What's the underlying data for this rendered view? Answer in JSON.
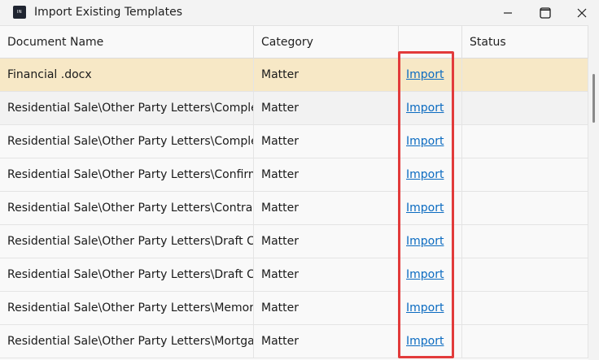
{
  "window": {
    "title": "Import Existing Templates",
    "app_icon_text": "IN"
  },
  "columns": {
    "document_name": "Document Name",
    "category": "Category",
    "action": "",
    "status": "Status"
  },
  "rows": [
    {
      "name": "Financial .docx",
      "category": "Matter",
      "action": "Import",
      "status": ""
    },
    {
      "name": "Residential Sale\\Other Party Letters\\Completion",
      "category": "Matter",
      "action": "Import",
      "status": ""
    },
    {
      "name": "Residential Sale\\Other Party Letters\\Completion",
      "category": "Matter",
      "action": "Import",
      "status": ""
    },
    {
      "name": "Residential Sale\\Other Party Letters\\Confirmation",
      "category": "Matter",
      "action": "Import",
      "status": ""
    },
    {
      "name": "Residential Sale\\Other Party Letters\\Contract Pa",
      "category": "Matter",
      "action": "Import",
      "status": ""
    },
    {
      "name": "Residential Sale\\Other Party Letters\\Draft Contra",
      "category": "Matter",
      "action": "Import",
      "status": ""
    },
    {
      "name": "Residential Sale\\Other Party Letters\\Draft Contra",
      "category": "Matter",
      "action": "Import",
      "status": ""
    },
    {
      "name": "Residential Sale\\Other Party Letters\\Memorandu",
      "category": "Matter",
      "action": "Import",
      "status": ""
    },
    {
      "name": "Residential Sale\\Other Party Letters\\Mortgage R",
      "category": "Matter",
      "action": "Import",
      "status": ""
    }
  ],
  "selected_row_index": 0,
  "colors": {
    "selected_row": "#f7e8c6",
    "link": "#0b6bc1",
    "highlight_box": "#e23b3b"
  },
  "icons": {
    "minimize": "minimize-icon",
    "maximize": "maximize-icon",
    "close": "close-icon"
  }
}
